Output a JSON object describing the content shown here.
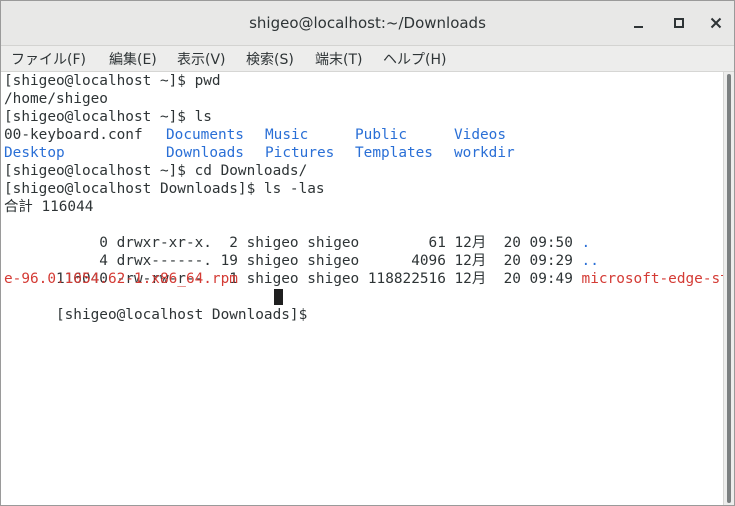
{
  "window": {
    "title": "shigeo@localhost:~/Downloads"
  },
  "menu": {
    "items": [
      {
        "label": "ファイル(F)"
      },
      {
        "label": "編集(E)"
      },
      {
        "label": "表示(V)"
      },
      {
        "label": "検索(S)"
      },
      {
        "label": "端末(T)"
      },
      {
        "label": "ヘルプ(H)"
      }
    ]
  },
  "terminal": {
    "lines": [
      {
        "text": "[shigeo@localhost ~]$ pwd"
      },
      {
        "text": "/home/shigeo"
      },
      {
        "text": "[shigeo@localhost ~]$ ls"
      },
      {
        "cells": [
          "00-keyboard.conf",
          "Documents",
          "Music",
          "Public",
          "Videos"
        ]
      },
      {
        "cells": [
          "Desktop",
          "Downloads",
          "Pictures",
          "Templates",
          "workdir"
        ]
      },
      {
        "text": "[shigeo@localhost ~]$ cd Downloads/"
      },
      {
        "text": "[shigeo@localhost Downloads]$ ls -las"
      },
      {
        "text": "合計 116044"
      },
      {
        "prefix": "     0 drwxr-xr-x.  2 shigeo shigeo        61 12月  20 09:50 ",
        "name": "."
      },
      {
        "prefix": "     4 drwx------. 19 shigeo shigeo      4096 12月  20 09:29 ",
        "name": ".."
      },
      {
        "prefix": "116040 -rw-rw-r--   1 shigeo shigeo 118822516 12月  20 09:49 ",
        "name": "microsoft-edge-stabl"
      },
      {
        "text": "e-96.0.1054.62-1.x86_64.rpm"
      },
      {
        "text": "[shigeo@localhost Downloads]$ "
      }
    ]
  },
  "colors": {
    "directory": "#2a6fd6",
    "package": "#d43b35",
    "text": "#2e3436"
  }
}
